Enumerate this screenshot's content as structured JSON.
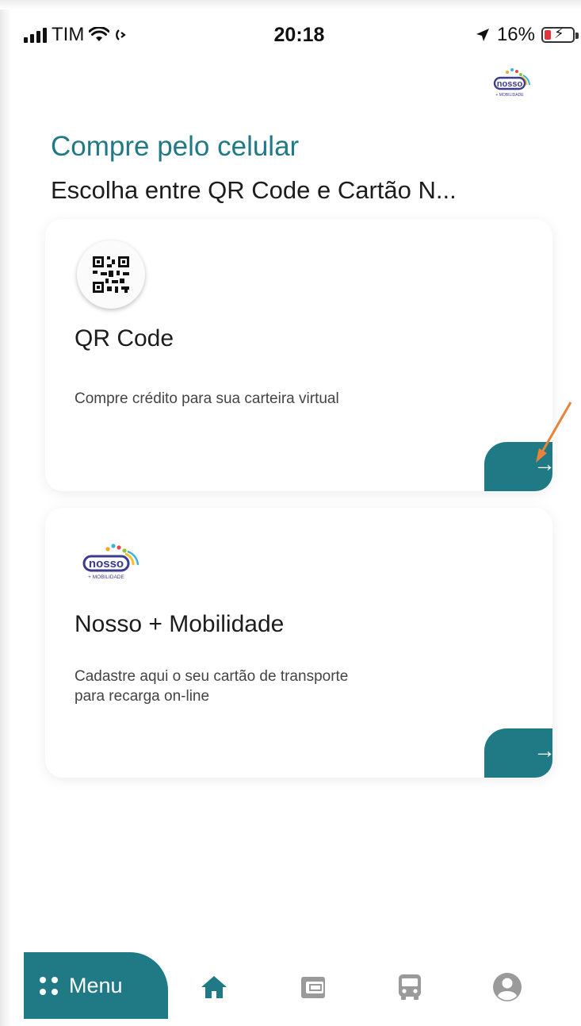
{
  "status_bar": {
    "carrier": "TIM",
    "time": "20:18",
    "battery_percent": "16%"
  },
  "header": {
    "logo_text": "nosso",
    "logo_subtext": "+ MOBILIDADE"
  },
  "page": {
    "title": "Compre pelo celular",
    "subtitle": "Escolha entre QR Code e Cartão N..."
  },
  "cards": [
    {
      "title": "QR Code",
      "description": "Compre crédito para sua carteira virtual",
      "icon": "qr-code-icon",
      "action_icon": "arrow-right-icon"
    },
    {
      "title": "Nosso + Mobilidade",
      "description_line1": "Cadastre aqui o seu cartão de transporte",
      "description_line2": "para recarga on-line",
      "icon": "nosso-mobilidade-logo",
      "action_icon": "arrow-right-icon"
    }
  ],
  "bottom_nav": {
    "menu_label": "Menu",
    "items": [
      "home-icon",
      "wallet-icon",
      "bus-icon",
      "profile-icon"
    ]
  },
  "colors": {
    "primary": "#1f7a86",
    "annotation": "#e8833a",
    "nav_inactive": "#9a9a9a"
  }
}
